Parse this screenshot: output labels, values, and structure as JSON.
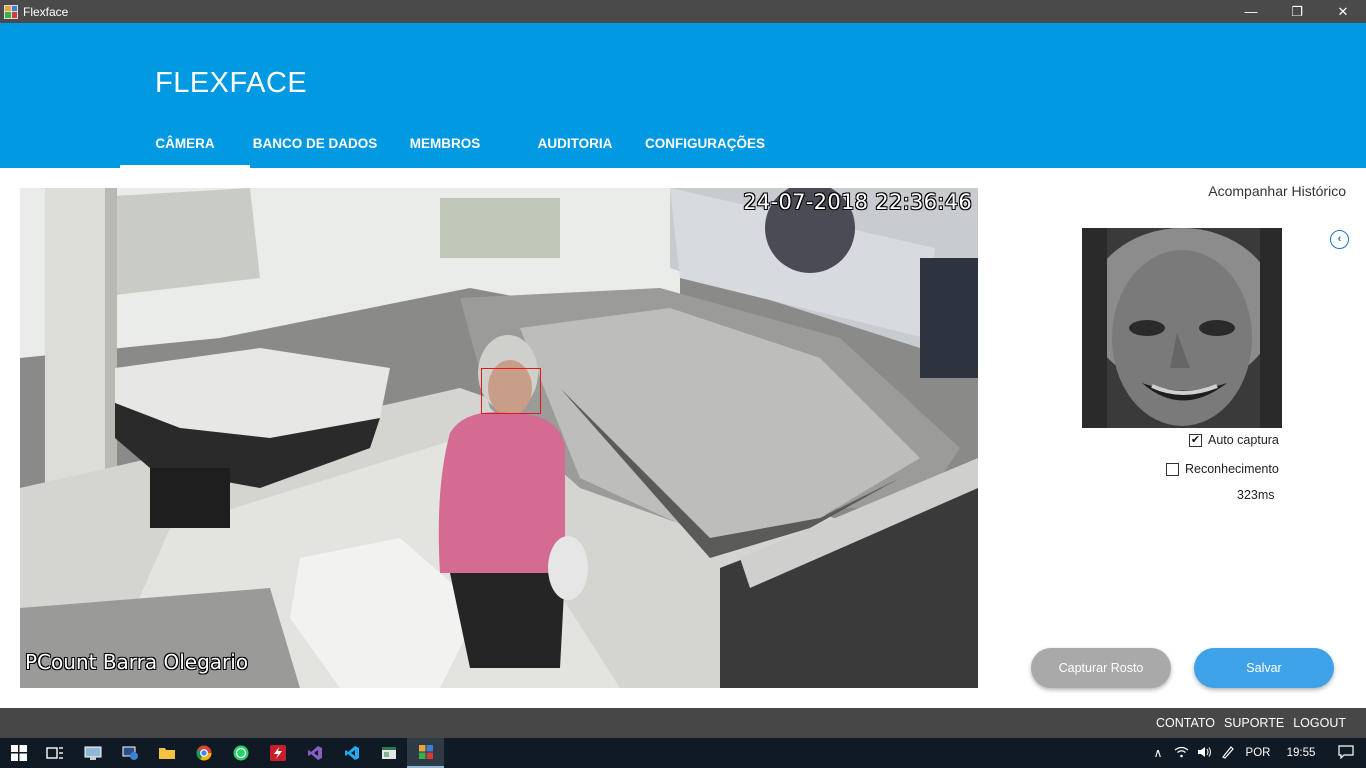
{
  "window": {
    "title": "Flexface",
    "minimize_glyph": "—",
    "maximize_glyph": "❐",
    "close_glyph": "✕"
  },
  "header": {
    "brand": "FLEXFACE",
    "tabs": [
      {
        "label": "CÂMERA",
        "active": true
      },
      {
        "label": "BANCO DE DADOS",
        "active": false
      },
      {
        "label": "MEMBROS",
        "active": false
      },
      {
        "label": "AUDITORIA",
        "active": false
      },
      {
        "label": "CONFIGURAÇÕES",
        "active": false
      }
    ]
  },
  "camera": {
    "timestamp": "24-07-2018 22:36:46",
    "label": "PCount Barra Olegario"
  },
  "panel": {
    "history_link": "Acompanhar Histórico",
    "collapse_icon": "chevron-left-icon",
    "auto_capture": {
      "label": "Auto captura",
      "checked": true
    },
    "recognition": {
      "label": "Reconhecimento",
      "checked": false
    },
    "latency": "323ms",
    "capture_button": "Capturar Rosto",
    "save_button": "Salvar"
  },
  "footer": {
    "links": [
      "CONTATO",
      "SUPORTE",
      "LOGOUT"
    ]
  },
  "taskbar": {
    "apps": [
      "windows-start-icon",
      "task-view-icon",
      "remote-desktop-icon",
      "network-app-icon",
      "file-explorer-icon",
      "chrome-icon",
      "whatsapp-icon",
      "flash-icon",
      "visual-studio-icon",
      "vscode-icon",
      "app-window-icon",
      "flexface-icon"
    ],
    "language": "POR",
    "time": "19:55"
  },
  "colors": {
    "header_blue": "#0199e2",
    "footer_gray": "#474747",
    "save_blue": "#3ea2e8",
    "capture_gray": "#a9a9a9",
    "face_box_red": "#e01818"
  }
}
